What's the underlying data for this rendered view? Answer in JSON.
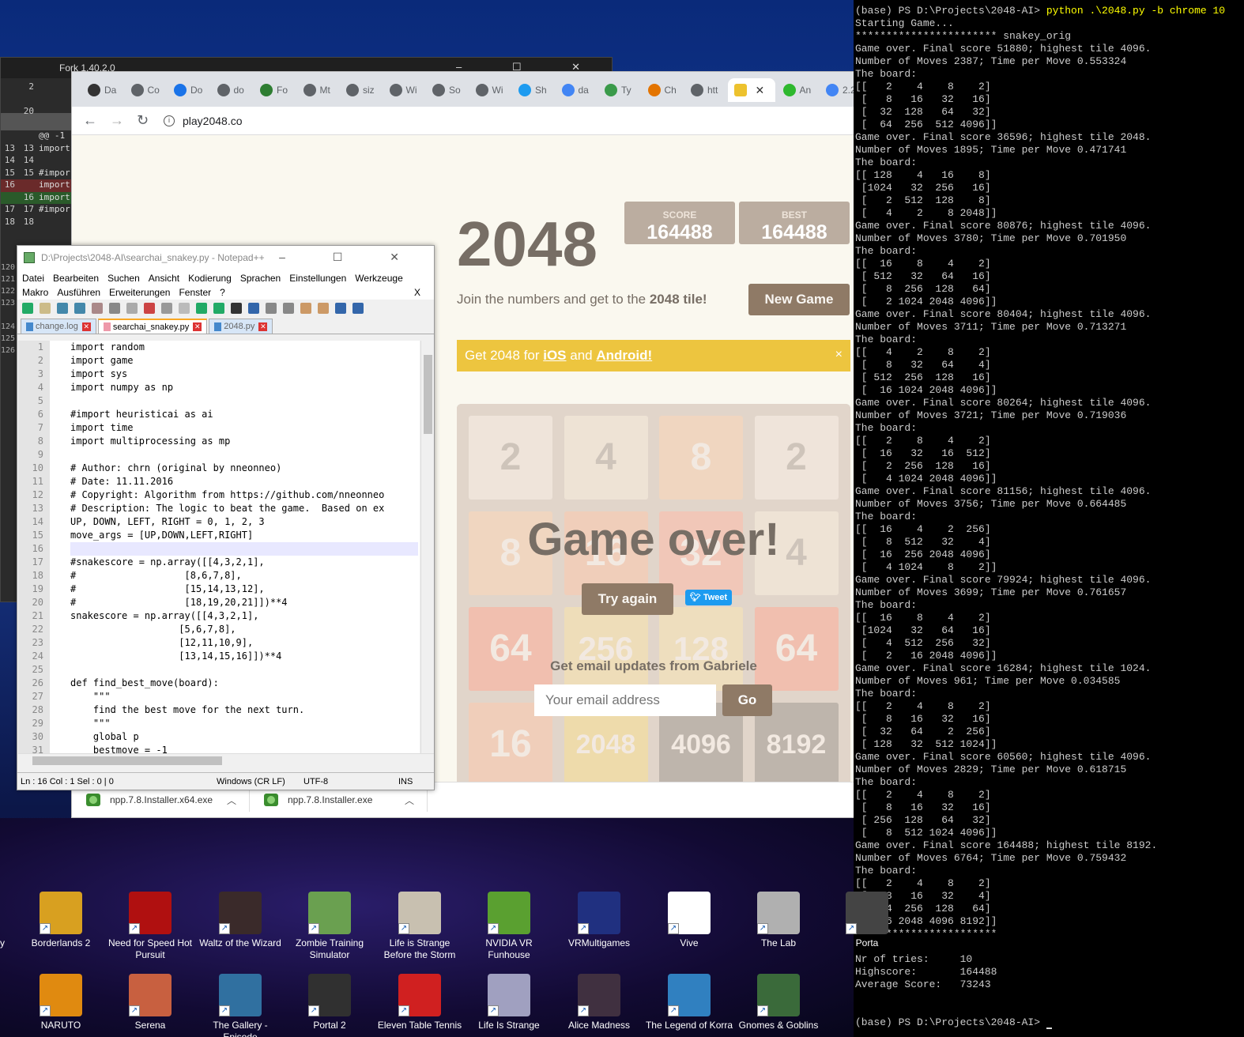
{
  "fork": {
    "title": "Fork 1.40.2.0",
    "gutter": [
      {
        "a": "",
        "b": "2",
        "t": ""
      },
      {
        "a": "",
        "b": "",
        "t": ""
      },
      {
        "a": "",
        "b": "20",
        "t": ""
      },
      {
        "a": "",
        "b": "",
        "t": ""
      },
      {
        "a": "",
        "b": "",
        "t": "@@ -1"
      },
      {
        "a": "13",
        "b": "13",
        "t": "import"
      },
      {
        "a": "14",
        "b": "14",
        "t": ""
      },
      {
        "a": "15",
        "b": "15",
        "t": "#impor"
      },
      {
        "a": "16",
        "b": "",
        "t": "import"
      },
      {
        "a": "",
        "b": "16",
        "t": "import"
      },
      {
        "a": "17",
        "b": "17",
        "t": "#impor"
      },
      {
        "a": "18",
        "b": "18",
        "t": ""
      }
    ],
    "left_nums": [
      "120",
      "121",
      "122",
      "123",
      "",
      "124",
      "125",
      "126"
    ]
  },
  "chrome": {
    "tabs": [
      "Da",
      "Co",
      "Do",
      "do",
      "Fo",
      "Mt",
      "siz",
      "Wi",
      "So",
      "Wi",
      "Sh",
      "da",
      "Ty",
      "Ch",
      "htt",
      "",
      "An",
      "2.2"
    ],
    "active_tab_index": 15,
    "url": "play2048.co",
    "downloads": [
      "npp.7.8.Installer.x64.exe",
      "npp.7.8.Installer.exe"
    ]
  },
  "game": {
    "title": "2048",
    "score_label": "SCORE",
    "score": "164488",
    "best_label": "BEST",
    "best": "164488",
    "intro_prefix": "Join the numbers and get to the ",
    "intro_bold": "2048 tile!",
    "new_game": "New Game",
    "banner_prefix": "Get 2048 for ",
    "banner_ios": "iOS",
    "banner_and": " and ",
    "banner_android": "Android!",
    "banner_close": "×",
    "tiles": [
      {
        "v": "2",
        "bg": "#eee4da",
        "fg": "#776e65"
      },
      {
        "v": "4",
        "bg": "#ede0c8",
        "fg": "#776e65"
      },
      {
        "v": "8",
        "bg": "#f2b179",
        "fg": "#f9f6f2"
      },
      {
        "v": "2",
        "bg": "#eee4da",
        "fg": "#776e65"
      },
      {
        "v": "8",
        "bg": "#f2b179",
        "fg": "#f9f6f2"
      },
      {
        "v": "16",
        "bg": "#f59563",
        "fg": "#f9f6f2"
      },
      {
        "v": "32",
        "bg": "#f67c5f",
        "fg": "#f9f6f2"
      },
      {
        "v": "4",
        "bg": "#ede0c8",
        "fg": "#776e65"
      },
      {
        "v": "64",
        "bg": "#f65e3b",
        "fg": "#f9f6f2"
      },
      {
        "v": "256",
        "bg": "#edcc61",
        "fg": "#f9f6f2"
      },
      {
        "v": "128",
        "bg": "#edcf72",
        "fg": "#f9f6f2"
      },
      {
        "v": "64",
        "bg": "#f65e3b",
        "fg": "#f9f6f2"
      },
      {
        "v": "16",
        "bg": "#f59563",
        "fg": "#f9f6f2"
      },
      {
        "v": "2048",
        "bg": "#edc22e",
        "fg": "#f9f6f2"
      },
      {
        "v": "4096",
        "bg": "#3c3a32",
        "fg": "#f9f6f2"
      },
      {
        "v": "8192",
        "bg": "#3c3a32",
        "fg": "#f9f6f2"
      }
    ],
    "game_over": "Game over!",
    "try_again": "Try again",
    "tweet": "Tweet",
    "email_heading": "Get email updates from Gabriele",
    "email_placeholder": "Your email address",
    "email_go": "Go"
  },
  "npp": {
    "title": "D:\\Projects\\2048-AI\\searchai_snakey.py - Notepad++",
    "menu_row1": [
      "Datei",
      "Bearbeiten",
      "Suchen",
      "Ansicht",
      "Kodierung",
      "Sprachen",
      "Einstellungen",
      "Werkzeuge"
    ],
    "menu_row2": [
      "Makro",
      "Ausführen",
      "Erweiterungen",
      "Fenster",
      "?"
    ],
    "menu_close": "X",
    "tabs": [
      {
        "label": "change.log",
        "active": false
      },
      {
        "label": "searchai_snakey.py",
        "active": true
      },
      {
        "label": "2048.py",
        "active": false
      }
    ],
    "lines": [
      "import random",
      "import game",
      "import sys",
      "import numpy as np",
      "",
      "#import heuristicai as ai",
      "import time",
      "import multiprocessing as mp",
      "",
      "# Author: chrn (original by nneonneo)",
      "# Date: 11.11.2016",
      "# Copyright: Algorithm from https://github.com/nneonneo",
      "# Description: The logic to beat the game.  Based on ex",
      "UP, DOWN, LEFT, RIGHT = 0, 1, 2, 3",
      "move_args = [UP,DOWN,LEFT,RIGHT]",
      "",
      "#snakescore = np.array([[4,3,2,1],",
      "#                   [8,6,7,8],",
      "#                   [15,14,13,12],",
      "#                   [18,19,20,21]])**4",
      "snakescore = np.array([[4,3,2,1],",
      "                   [5,6,7,8],",
      "                   [12,11,10,9],",
      "                   [13,14,15,16]])**4",
      "",
      "def find_best_move(board):",
      "    \"\"\"",
      "    find the best move for the next turn.",
      "    \"\"\"",
      "    global p",
      "    bestmove = -1"
    ],
    "status": {
      "pos": "Ln : 16    Col : 1    Sel : 0 | 0",
      "eol": "Windows (CR LF)",
      "enc": "UTF-8",
      "mode": "INS"
    }
  },
  "terminal": {
    "lines": [
      "(base) PS D:\\Projects\\2048-AI> ",
      "Starting Game...",
      "*********************** snakey_orig",
      "Game over. Final score 51880; highest tile 4096.",
      "Number of Moves 2387; Time per Move 0.553324",
      "The board:",
      "[[   2    4    8    2]",
      " [   8   16   32   16]",
      " [  32  128   64   32]",
      " [  64  256  512 4096]]",
      "Game over. Final score 36596; highest tile 2048.",
      "Number of Moves 1895; Time per Move 0.471741",
      "The board:",
      "[[ 128    4   16    8]",
      " [1024   32  256   16]",
      " [   2  512  128    8]",
      " [   4    2    8 2048]]",
      "Game over. Final score 80876; highest tile 4096.",
      "Number of Moves 3780; Time per Move 0.701950",
      "The board:",
      "[[  16    8    4    2]",
      " [ 512   32   64   16]",
      " [   8  256  128   64]",
      " [   2 1024 2048 4096]]",
      "Game over. Final score 80404; highest tile 4096.",
      "Number of Moves 3711; Time per Move 0.713271",
      "The board:",
      "[[   4    2    8    2]",
      " [   8   32   64    4]",
      " [ 512  256  128   16]",
      " [  16 1024 2048 4096]]",
      "Game over. Final score 80264; highest tile 4096.",
      "Number of Moves 3721; Time per Move 0.719036",
      "The board:",
      "[[   2    8    4    2]",
      " [  16   32   16  512]",
      " [   2  256  128   16]",
      " [   4 1024 2048 4096]]",
      "Game over. Final score 81156; highest tile 4096.",
      "Number of Moves 3756; Time per Move 0.664485",
      "The board:",
      "[[  16    4    2  256]",
      " [   8  512   32    4]",
      " [  16  256 2048 4096]",
      " [   4 1024    8    2]]",
      "Game over. Final score 79924; highest tile 4096.",
      "Number of Moves 3699; Time per Move 0.761657",
      "The board:",
      "[[  16    8    4    2]",
      " [1024   32   64   16]",
      " [   4  512  256   32]",
      " [   2   16 2048 4096]]",
      "Game over. Final score 16284; highest tile 1024.",
      "Number of Moves 961; Time per Move 0.034585",
      "The board:",
      "[[   2    4    8    2]",
      " [   8   16   32   16]",
      " [  32   64    2  256]",
      " [ 128   32  512 1024]]",
      "Game over. Final score 60560; highest tile 4096.",
      "Number of Moves 2829; Time per Move 0.618715",
      "The board:",
      "[[   2    4    8    2]",
      " [   8   16   32   16]",
      " [ 256  128   64   32]",
      " [   8  512 1024 4096]]",
      "Game over. Final score 164488; highest tile 8192.",
      "Number of Moves 6764; Time per Move 0.759432",
      "The board:",
      "[[   2    4    8    2]",
      " [   8   16   32    4]",
      " [  64  256  128   64]",
      " [  16 2048 4096 8192]]",
      "***********************",
      "",
      "Nr of tries:     10",
      "Highscore:       164488",
      "Average Score:   73243",
      "",
      "",
      "(base) PS D:\\Projects\\2048-AI> "
    ],
    "command": "python .\\2048.py -b chrome 10"
  },
  "desktop": {
    "row1": [
      {
        "label": "Borderlands 2",
        "color": "#d8a020"
      },
      {
        "label": "Need for Speed Hot Pursuit",
        "color": "#b01010"
      },
      {
        "label": "Waltz of the Wizard",
        "color": "#3a2a2a"
      },
      {
        "label": "Zombie Training Simulator",
        "color": "#6aa050"
      },
      {
        "label": "Life is Strange Before the Storm",
        "color": "#c8c0b0"
      },
      {
        "label": "NVIDIA VR Funhouse",
        "color": "#5aa030"
      },
      {
        "label": "VRMultigames",
        "color": "#203080"
      },
      {
        "label": "Vive",
        "color": "#ffffff"
      },
      {
        "label": "The Lab",
        "color": "#b0b0b0"
      },
      {
        "label": "Porta",
        "color": "#444444"
      }
    ],
    "row2": [
      {
        "label": "NARUTO",
        "color": "#e08a10"
      },
      {
        "label": "Serena",
        "color": "#c86040"
      },
      {
        "label": "The Gallery - Episode",
        "color": "#3070a0"
      },
      {
        "label": "Portal 2",
        "color": "#303030"
      },
      {
        "label": "Eleven Table Tennis",
        "color": "#d02020"
      },
      {
        "label": "Life Is Strange",
        "color": "#a0a0c0"
      },
      {
        "label": "Alice Madness",
        "color": "#403040"
      },
      {
        "label": "The Legend of Korra",
        "color": "#3080c0"
      },
      {
        "label": "Gnomes & Goblins",
        "color": "#3a6a3a"
      }
    ],
    "left_edge_label": "y"
  }
}
